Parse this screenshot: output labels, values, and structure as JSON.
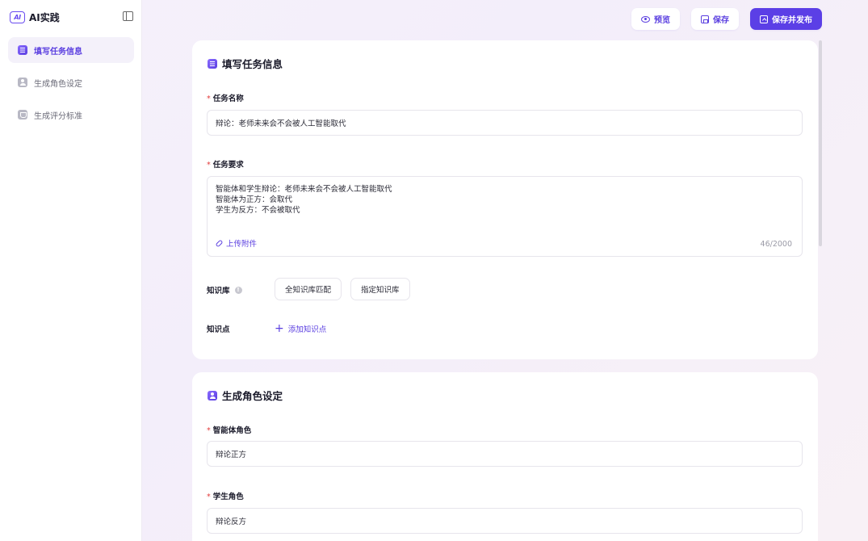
{
  "brand": {
    "logo_text": "AI",
    "name": "AI实践"
  },
  "sidebar": {
    "items": [
      {
        "label": "填写任务信息",
        "active": true
      },
      {
        "label": "生成角色设定",
        "active": false
      },
      {
        "label": "生成评分标准",
        "active": false
      }
    ]
  },
  "toolbar": {
    "preview_label": "预览",
    "save_label": "保存",
    "publish_label": "保存并发布"
  },
  "task_card": {
    "title": "填写任务信息",
    "required_mark": "*",
    "task_name_label": "任务名称",
    "task_name_value": "辩论：老师未来会不会被人工智能取代",
    "task_req_label": "任务要求",
    "task_req_lines": [
      "智能体和学生辩论：老师未来会不会被人工智能取代",
      "智能体为正方：会取代",
      "学生为反方：不会被取代"
    ],
    "upload_label": "上传附件",
    "char_count": "46/2000",
    "kb_label": "知识库",
    "kb_info_glyph": "!",
    "kb_option_all": "全知识库匹配",
    "kb_option_specific": "指定知识库",
    "kp_label": "知识点",
    "kp_add_label": "添加知识点",
    "plus_glyph": "+"
  },
  "role_card": {
    "title": "生成角色设定",
    "agent_role_label": "智能体角色",
    "agent_role_value": "辩论正方",
    "student_role_label": "学生角色",
    "student_role_value": "辩论反方"
  },
  "colors": {
    "accent": "#5b3fe6",
    "required": "#e33b3b",
    "border": "#e7e5ec"
  }
}
